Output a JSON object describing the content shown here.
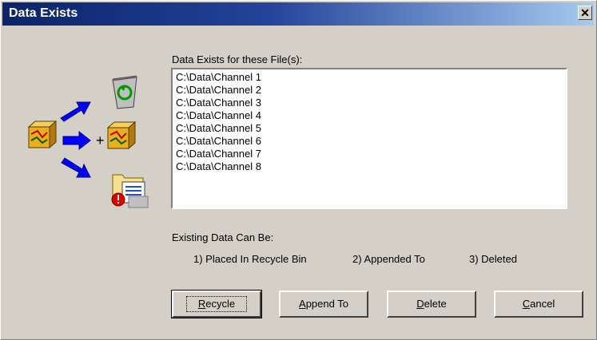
{
  "window": {
    "title": "Data Exists",
    "close_glyph": "✕"
  },
  "files_label": "Data Exists for these File(s):",
  "files": [
    "C:\\Data\\Channel 1",
    "C:\\Data\\Channel 2",
    "C:\\Data\\Channel 3",
    "C:\\Data\\Channel 4",
    "C:\\Data\\Channel 5",
    "C:\\Data\\Channel 6",
    "C:\\Data\\Channel 7",
    "C:\\Data\\Channel 8"
  ],
  "options_label": "Existing Data Can Be:",
  "options": [
    "1) Placed In Recycle Bin",
    "2) Appended To",
    "3) Deleted"
  ],
  "buttons": {
    "recycle": {
      "mnemonic": "R",
      "rest": "ecycle"
    },
    "append": {
      "mnemonic": "A",
      "rest": "ppend To"
    },
    "delete": {
      "mnemonic": "D",
      "rest": "elete"
    },
    "cancel": {
      "mnemonic": "C",
      "rest": "ancel"
    }
  },
  "diagram": {
    "plus": "+"
  },
  "colors": {
    "titlebar_start": "#0a246a",
    "titlebar_end": "#a6caf0",
    "dialog_bg": "#d4d0c8",
    "arrow": "#0000ff"
  }
}
